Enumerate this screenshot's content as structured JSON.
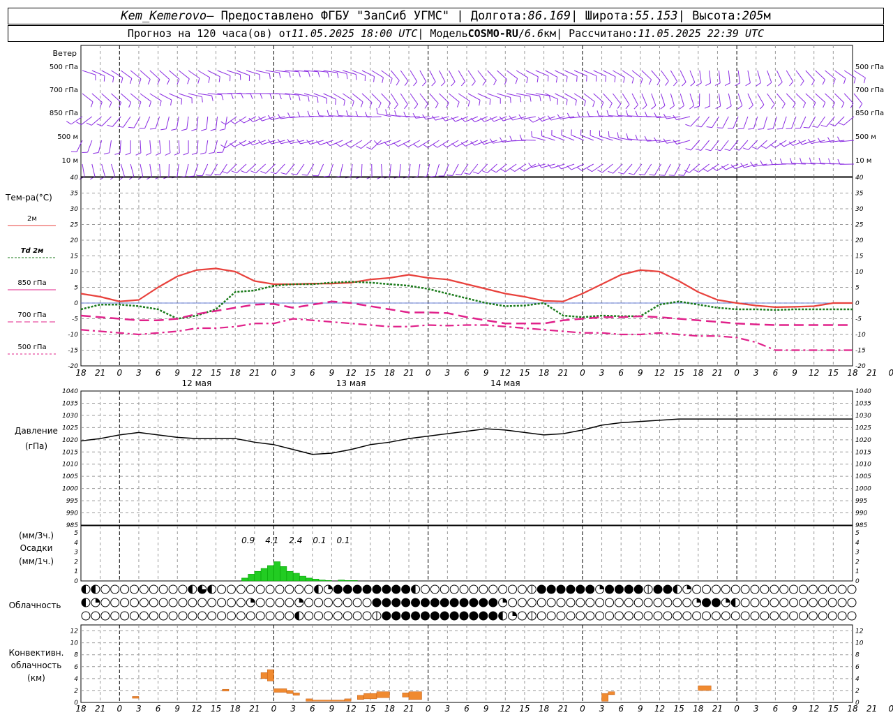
{
  "header": {
    "station": "Kem_Kemerovo",
    "provider": " — Предоставлено ФГБУ \"ЗапСиб УГМС\" | Долгота: ",
    "lon": "86.169",
    "lat_label": " | Широта: ",
    "lat": "55.153",
    "alt_label": " | Высота: ",
    "alt": "205",
    "alt_unit": "м",
    "forecast_label": "Прогноз на 120 часа(ов) от ",
    "forecast_from": "11.05.2025 18:00 UTC",
    "model_label": " | Модель ",
    "model": "COSMO-RU",
    "res_sep": " / ",
    "res": "6.6",
    "res_unit": "км",
    "calc_label": " | Рассчитано: ",
    "calc_time": "11.05.2025 22:39 UTC"
  },
  "colors": {
    "wind": "#8a2be2",
    "t2m": "#e8413c",
    "td2m": "#1a7a1a",
    "t850": "#e0218a",
    "t700": "#e0218a",
    "t500": "#e0218a",
    "precip": "#22cc22",
    "conv": "#f08a30",
    "grid": "#999999"
  },
  "wind_panel": {
    "title": "Ветер",
    "levels": [
      "500 гПа",
      "700 гПа",
      "850 гПа",
      "500 м",
      "10  м"
    ]
  },
  "temp_panel": {
    "title": "Тем-ра(°C)",
    "legend": [
      "2м",
      "Td  2м",
      "850 гПа",
      "700 гПа",
      "500 гПа"
    ]
  },
  "pressure_panel": {
    "title": "Давление",
    "unit": "(гПа)"
  },
  "precip_panel": {
    "title_top": "(мм/3ч.)",
    "title": "Осадки",
    "title_bottom": "(мм/1ч.)",
    "labels_3h": [
      "0.9",
      "4.1",
      "2.4",
      "0.1",
      "0.1"
    ]
  },
  "cloud_panel": {
    "title": "Облачность"
  },
  "conv_panel": {
    "title": [
      "Конвективн.",
      "облачность",
      "(км)"
    ]
  },
  "chart_data": [
    {
      "type": "line",
      "title": "Тем-ра(°C)",
      "x_hours": [
        0,
        3,
        6,
        9,
        12,
        15,
        18,
        21,
        24,
        27,
        30,
        33,
        36,
        39,
        42,
        45,
        48,
        51,
        54,
        57,
        60,
        63,
        66,
        69,
        72,
        75,
        78,
        81,
        84,
        87,
        90,
        93,
        96,
        99,
        102,
        105,
        108,
        111,
        114,
        117,
        120
      ],
      "x_tick_labels": [
        "18",
        "21",
        "0",
        "3",
        "6",
        "9",
        "12",
        "15",
        "18",
        "21",
        "0",
        "3",
        "6",
        "9",
        "12",
        "15",
        "18",
        "21",
        "0",
        "3",
        "6",
        "9",
        "12",
        "15",
        "18",
        "21",
        "0",
        "3",
        "6",
        "9",
        "12",
        "15",
        "18",
        "21",
        "0",
        "3",
        "6",
        "9",
        "12",
        "15",
        "18",
        "21",
        "0"
      ],
      "day_labels": [
        "12 мая",
        "13 мая",
        "14 мая"
      ],
      "ylim": [
        -20,
        40
      ],
      "series": [
        {
          "name": "2м",
          "values": [
            3,
            2,
            0.5,
            1,
            5,
            8.5,
            10.5,
            11,
            10,
            7,
            6,
            6,
            6.2,
            6.2,
            6.5,
            7.5,
            8,
            9,
            8,
            7.5,
            6,
            4.5,
            3,
            2,
            0.7,
            0.5,
            3,
            6,
            9,
            10.5,
            10,
            7,
            3.5,
            1,
            0,
            -0.8,
            -1.3,
            -1.2,
            -1,
            0,
            0
          ]
        },
        {
          "name": "Td  2м",
          "values": [
            -2,
            -0.5,
            -0.5,
            -1,
            -2,
            -5,
            -4,
            -2,
            3.5,
            4,
            5.5,
            6,
            6,
            6.5,
            6.8,
            6.5,
            6,
            5.5,
            4.5,
            3,
            1.5,
            0,
            -1,
            -0.8,
            0,
            -4,
            -4.5,
            -4,
            -4.2,
            -4.2,
            -0.5,
            0.5,
            -0.5,
            -1.5,
            -2,
            -2,
            -2.2,
            -2,
            -2,
            -2,
            -2
          ]
        },
        {
          "name": "850 гПа",
          "values": [
            -4,
            -4.5,
            -5,
            -5.5,
            -5.5,
            -5,
            -3.5,
            -2.5,
            -1.5,
            -0.5,
            -0.3,
            -1.5,
            -0.5,
            0.5,
            0,
            -1,
            -2,
            -3,
            -3,
            -3.2,
            -4.5,
            -5.5,
            -6.5,
            -6.5,
            -6.5,
            -5.5,
            -5,
            -4.5,
            -4.5,
            -4.2,
            -4.5,
            -5,
            -5.5,
            -6,
            -6.5,
            -6.8,
            -7,
            -7,
            -7,
            -7,
            -7
          ]
        },
        {
          "name": "700 гПа",
          "values": [
            -8.5,
            -9,
            -9.5,
            -10,
            -9.5,
            -9,
            -8,
            -8,
            -7.5,
            -6.5,
            -6.5,
            -5,
            -5.5,
            -6,
            -6.5,
            -7,
            -7.5,
            -7.5,
            -7,
            -7.2,
            -7,
            -7,
            -7.5,
            -8,
            -8.5,
            -9,
            -9.5,
            -9.5,
            -10,
            -10,
            -9.5,
            -10,
            -10.5,
            -10.5,
            -11,
            -12.5,
            -15,
            -15,
            -15,
            -15,
            -15
          ]
        }
      ]
    },
    {
      "type": "line",
      "title": "Давление",
      "ylabel": "(гПа)",
      "ylim": [
        985,
        1040
      ],
      "series": [
        {
          "name": "Давление",
          "values": [
            1019.5,
            1020.5,
            1022,
            1023,
            1022,
            1021,
            1020.5,
            1020.5,
            1020.5,
            1019,
            1018,
            1016,
            1014,
            1014.5,
            1016,
            1018,
            1019,
            1020.5,
            1021.5,
            1022.5,
            1023.5,
            1024.5,
            1024,
            1023,
            1022,
            1022.5,
            1024,
            1026,
            1027,
            1027.5,
            1028,
            1028.5,
            1028.5,
            1028.5,
            1028.5,
            1028.5,
            1028.5,
            1028.5,
            1028.5,
            1028.5,
            1028.5
          ]
        }
      ]
    },
    {
      "type": "bar",
      "title": "Осадки",
      "ylabel": "(мм/1ч.)",
      "ylim": [
        0,
        5
      ],
      "x_hours": [
        25,
        26,
        27,
        28,
        29,
        30,
        31,
        32,
        33,
        34,
        35,
        36,
        37,
        38,
        40,
        41,
        42
      ],
      "values": [
        0.3,
        0.7,
        1.0,
        1.3,
        1.6,
        2.0,
        1.5,
        1.0,
        0.8,
        0.5,
        0.3,
        0.2,
        0.1,
        0.05,
        0.1,
        0.05,
        0.05
      ]
    },
    {
      "type": "bar",
      "title": "Конвективн. облачность (км)",
      "ylim": [
        0,
        13
      ],
      "bars": [
        {
          "from": 8,
          "to": 9,
          "bottom": 0.7,
          "top": 1
        },
        {
          "from": 22,
          "to": 23,
          "bottom": 1.9,
          "top": 2.2
        },
        {
          "from": 28,
          "to": 29,
          "bottom": 4,
          "top": 5
        },
        {
          "from": 29,
          "to": 30,
          "bottom": 3.6,
          "top": 5.5
        },
        {
          "from": 30,
          "to": 32,
          "bottom": 1.7,
          "top": 2.3
        },
        {
          "from": 32,
          "to": 33,
          "bottom": 1.5,
          "top": 2.0
        },
        {
          "from": 33,
          "to": 34,
          "bottom": 1.2,
          "top": 1.6
        },
        {
          "from": 35,
          "to": 36,
          "bottom": 0.2,
          "top": 0.6
        },
        {
          "from": 36,
          "to": 41,
          "bottom": 0.2,
          "top": 0.4
        },
        {
          "from": 41,
          "to": 42,
          "bottom": 0.2,
          "top": 0.6
        },
        {
          "from": 43,
          "to": 44,
          "bottom": 0.5,
          "top": 1.2
        },
        {
          "from": 44,
          "to": 46,
          "bottom": 0.6,
          "top": 1.5
        },
        {
          "from": 46,
          "to": 48,
          "bottom": 0.8,
          "top": 1.8
        },
        {
          "from": 50,
          "to": 51,
          "bottom": 0.9,
          "top": 1.6
        },
        {
          "from": 51,
          "to": 53,
          "bottom": 0.5,
          "top": 1.8
        },
        {
          "from": 81,
          "to": 82,
          "bottom": 0.2,
          "top": 1.5
        },
        {
          "from": 82,
          "to": 83,
          "bottom": 1.3,
          "top": 1.8
        },
        {
          "from": 96,
          "to": 98,
          "bottom": 2.0,
          "top": 2.8
        }
      ]
    },
    {
      "type": "table",
      "title": "Облачность",
      "rows": [
        "hhooooooooohQhoooooooooohqFFFFFFFFhoooooooooooHFFFFFFqFFFFHFFhqoooooooooooooooooooooooooooooooooooooooooooooooooo",
        "hqoooooooooooooooqooooqoooooooFFFFFFFFFFFFFqoooooooooooooooooooqFFqhoooooooooooooooooooooooooooooooooqoooooooooooooo",
        "oooooooooooooooooooooohoooooooHFFFFFFFFFFFFhqoHoooooooooooooooooooooooooooooooooooooooqqqqooooooooooooooooooooooooo"
      ]
    }
  ]
}
